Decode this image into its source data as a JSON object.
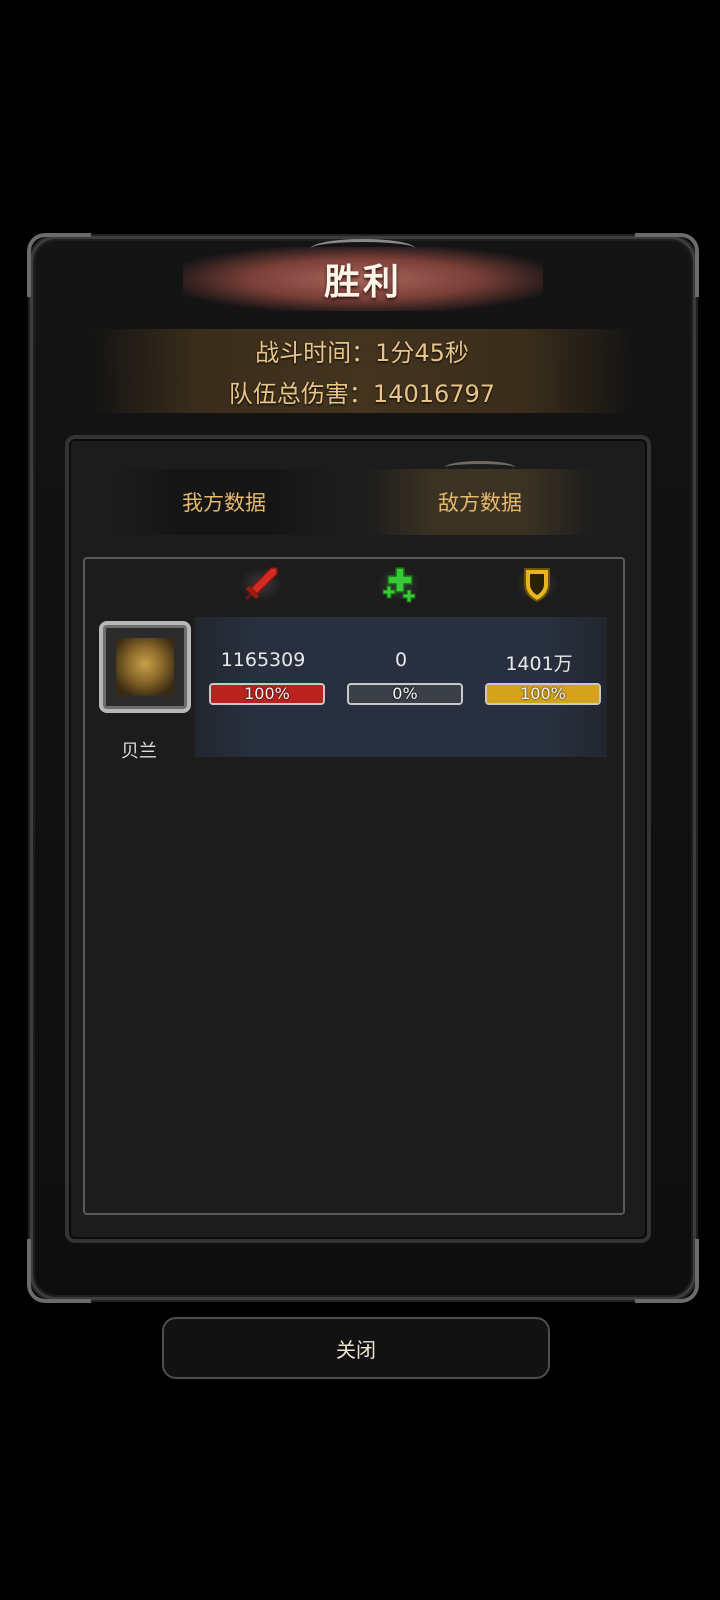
{
  "result": {
    "title": "胜利"
  },
  "summary": {
    "battle_time": "战斗时间：1分45秒",
    "team_damage": "队伍总伤害：14016797"
  },
  "tabs": [
    {
      "label": "我方数据",
      "selected": false
    },
    {
      "label": "敌方数据",
      "selected": true
    }
  ],
  "columns": [
    {
      "icon": "sword-icon",
      "color": "#d32a22"
    },
    {
      "icon": "heal-cross-icon",
      "color": "#37c936"
    },
    {
      "icon": "shield-icon",
      "color": "#e7b51c"
    }
  ],
  "heroes": [
    {
      "name": "贝兰",
      "avatar_icon": "dragon-portrait",
      "damage": "1165309",
      "damage_pct": "100%",
      "damage_fraction": 1.0,
      "healing": "0",
      "healing_pct": "0%",
      "healing_fraction": 0.0,
      "tanked": "1401万",
      "tanked_pct": "100%",
      "tanked_fraction": 1.0
    }
  ],
  "bar_colors": {
    "damage": "#b8231d",
    "healing": "#4a505b",
    "tanked": "#d4a21c"
  },
  "footer": {
    "close_label": "关闭"
  }
}
